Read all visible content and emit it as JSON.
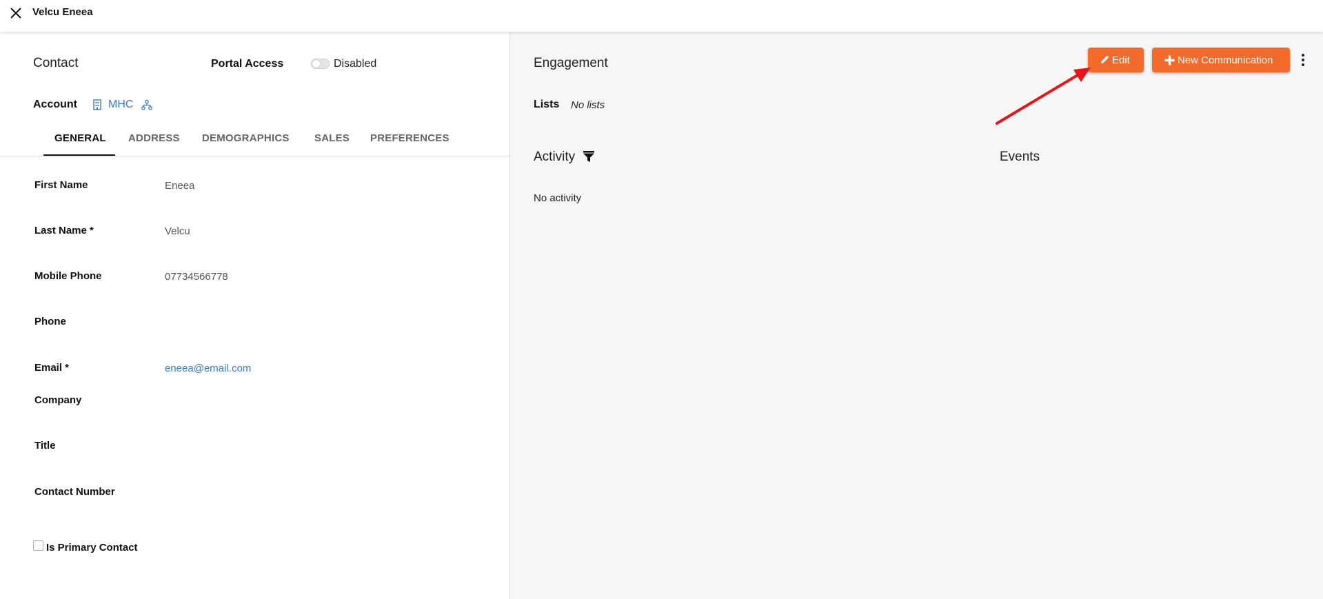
{
  "window": {
    "title": "Velcu Eneea",
    "close_icon": "close-icon"
  },
  "contact": {
    "heading": "Contact",
    "portal_access_label": "Portal Access",
    "portal_access_state": "Disabled",
    "account_label": "Account",
    "account_name": "MHC",
    "account_icon": "building-icon",
    "hierarchy_icon": "hierarchy-icon"
  },
  "tabs": [
    {
      "label": "GENERAL",
      "active": true
    },
    {
      "label": "ADDRESS",
      "active": false
    },
    {
      "label": "DEMOGRAPHICS",
      "active": false
    },
    {
      "label": "SALES",
      "active": false
    },
    {
      "label": "PREFERENCES",
      "active": false
    }
  ],
  "fields": [
    {
      "label": "First Name",
      "value": "Eneea"
    },
    {
      "label": "Last Name *",
      "value": "Velcu"
    },
    {
      "label": "Mobile Phone",
      "value": "07734566778"
    },
    {
      "label": "Phone",
      "value": ""
    },
    {
      "label": "Email *",
      "value": "eneea@email.com"
    },
    {
      "label": "Company",
      "value": ""
    },
    {
      "label": "Title",
      "value": ""
    },
    {
      "label": "Contact Number",
      "value": ""
    }
  ],
  "primary_contact": {
    "label": "Is Primary Contact",
    "checked": false
  },
  "engagement": {
    "heading": "Engagement",
    "edit_label": "Edit",
    "new_communication_label": "New Communication",
    "lists_label": "Lists",
    "lists_value": "No lists",
    "activity_heading": "Activity",
    "activity_empty": "No activity",
    "events_heading": "Events"
  },
  "colors": {
    "accent": "#f26b2a",
    "link": "#3a78c2",
    "annotation_arrow": "#e8141b"
  }
}
